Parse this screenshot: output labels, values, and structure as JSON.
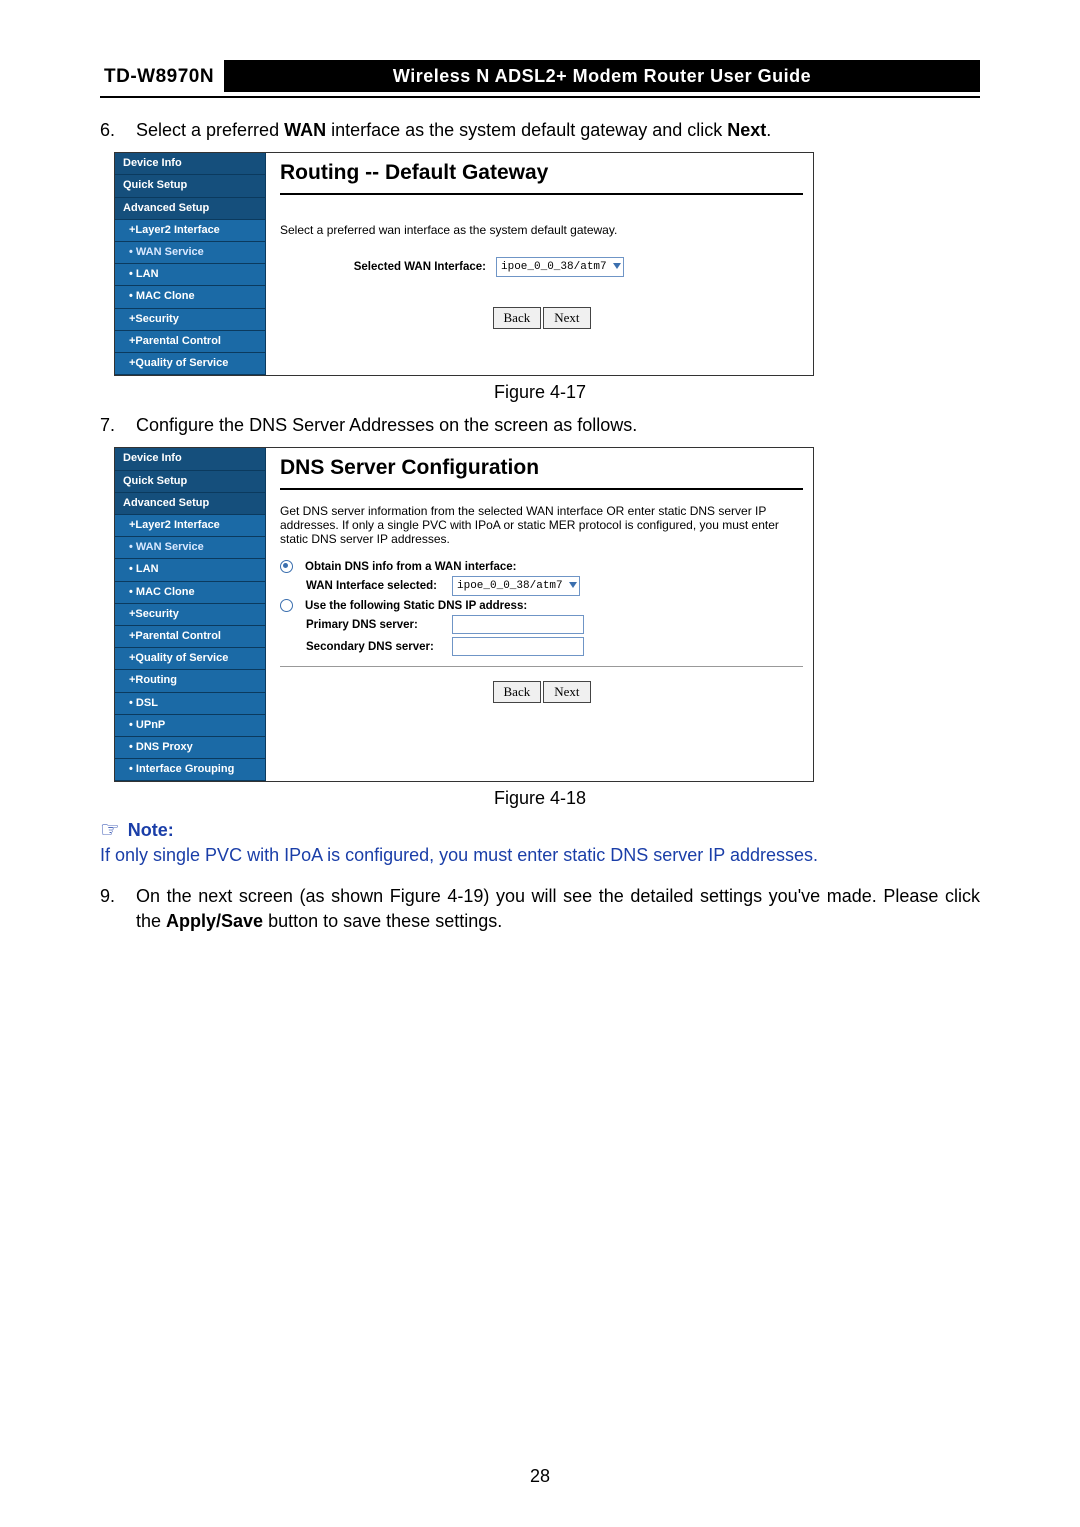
{
  "header": {
    "model": "TD-W8970N",
    "title": "Wireless N ADSL2+ Modem Router User Guide"
  },
  "steps": {
    "s6": {
      "num": "6.",
      "pre": "Select a preferred ",
      "b1": "WAN",
      "mid": " interface as the system default gateway and click ",
      "b2": "Next",
      "post": "."
    },
    "s7": {
      "num": "7.",
      "text": "Configure the DNS Server Addresses on the screen as follows."
    },
    "s9": {
      "num": "9.",
      "pre": "On the next screen (as shown Figure 4-19) you will see the detailed settings you've made. Please click the ",
      "b1": "Apply/Save",
      "post": " button to save these settings."
    }
  },
  "fig17": {
    "caption": "Figure 4-17",
    "nav": [
      "Device Info",
      "Quick Setup",
      "Advanced Setup",
      "+Layer2 Interface",
      "• WAN Service",
      "• LAN",
      "• MAC Clone",
      "+Security",
      "+Parental Control",
      "+Quality of Service"
    ],
    "title": "Routing -- Default Gateway",
    "desc": "Select a preferred wan interface as the system default gateway.",
    "row_label": "Selected WAN Interface:",
    "select_val": "ipoe_0_0_38/atm7",
    "btn_back": "Back",
    "btn_next": "Next"
  },
  "fig18": {
    "caption": "Figure 4-18",
    "nav": [
      "Device Info",
      "Quick Setup",
      "Advanced Setup",
      "+Layer2 Interface",
      "• WAN Service",
      "• LAN",
      "• MAC Clone",
      "+Security",
      "+Parental Control",
      "+Quality of Service",
      "+Routing",
      "• DSL",
      "• UPnP",
      "• DNS Proxy",
      "• Interface Grouping"
    ],
    "title": "DNS Server Configuration",
    "desc": "Get DNS server information from the selected WAN interface OR enter static DNS server IP addresses. If only a single PVC with IPoA or static MER protocol is configured, you must enter static DNS server IP addresses.",
    "radio1": "Obtain DNS info from a WAN interface:",
    "wan_sel_label": "WAN Interface selected:",
    "select_val": "ipoe_0_0_38/atm7",
    "radio2": "Use the following Static DNS IP address:",
    "primary": "Primary DNS server:",
    "secondary": "Secondary DNS server:",
    "btn_back": "Back",
    "btn_next": "Next"
  },
  "note": {
    "label": "Note:",
    "body": "If only single PVC with IPoA is configured, you must enter static DNS server IP addresses."
  },
  "page_number": "28"
}
